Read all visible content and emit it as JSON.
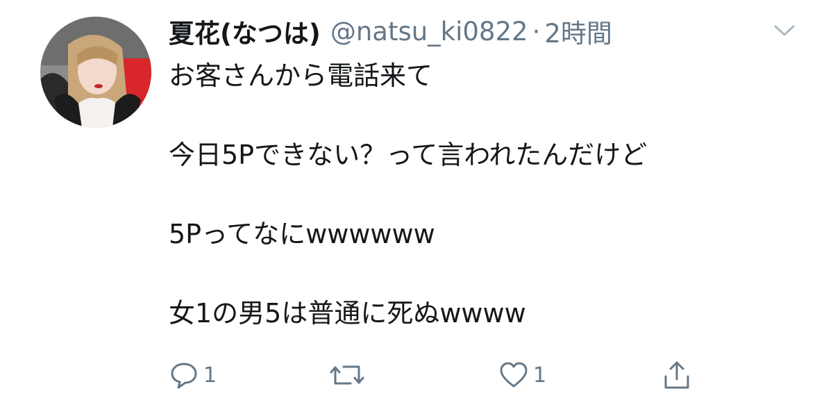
{
  "tweet": {
    "display_name": "夏花(なつは)",
    "handle": "@natsu_ki0822",
    "separator": "·",
    "time": "2時間",
    "lines": [
      "お客さんから電話来て",
      "",
      "今日5Pできない？って言われたんだけど",
      "",
      "5Pってなにwwwwww",
      "",
      "女1の男5は普通に死ぬwwww"
    ],
    "actions": {
      "reply_count": "1",
      "retweet_count": "",
      "like_count": "1"
    }
  },
  "colors": {
    "text_primary": "#14171a",
    "text_secondary": "#657786",
    "chevron": "#aab8c2"
  },
  "icons": [
    "avatar-photo",
    "chevron-down-icon",
    "reply-icon",
    "retweet-icon",
    "like-icon",
    "share-icon"
  ]
}
